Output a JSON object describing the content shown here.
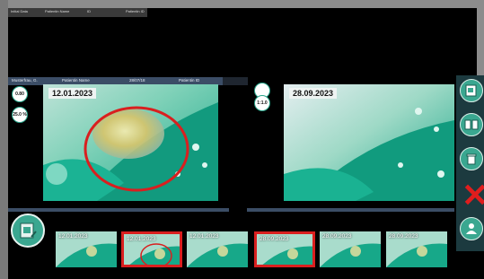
{
  "top_bar": {
    "fields": [
      "Initial Data",
      "Patientin Name",
      "ID",
      "Patientin ID"
    ]
  },
  "left_pane": {
    "header": [
      "Musterfrau, G.",
      "Patientin Name",
      "28/07/18",
      "Patientin ID"
    ],
    "date_label": "12.01.2023",
    "zoom_buttons": [
      "0.80",
      "25.0 %"
    ]
  },
  "right_pane": {
    "date_label": "28.09.2023",
    "zoom_buttons": [
      "",
      "1:1.0"
    ]
  },
  "thumbnails": [
    {
      "date": "12.01.2023",
      "selected": false
    },
    {
      "date": "12.01.2023",
      "selected": true
    },
    {
      "date": "12.01.2023",
      "selected": false
    },
    {
      "date": "28.09.2023",
      "selected": true
    },
    {
      "date": "28.09.2023",
      "selected": false
    },
    {
      "date": "28.09.2023",
      "selected": false
    }
  ],
  "toolbar": {
    "icons": [
      "import-image-icon",
      "compare-view-icon",
      "trash-icon",
      "close-x-icon",
      "user-manage-icon"
    ]
  },
  "gallery_button": {
    "icon": "gallery-edit-icon"
  },
  "colors": {
    "accent": "#2aa58b",
    "header": "#3b4d66",
    "marker": "#d91f1f"
  }
}
